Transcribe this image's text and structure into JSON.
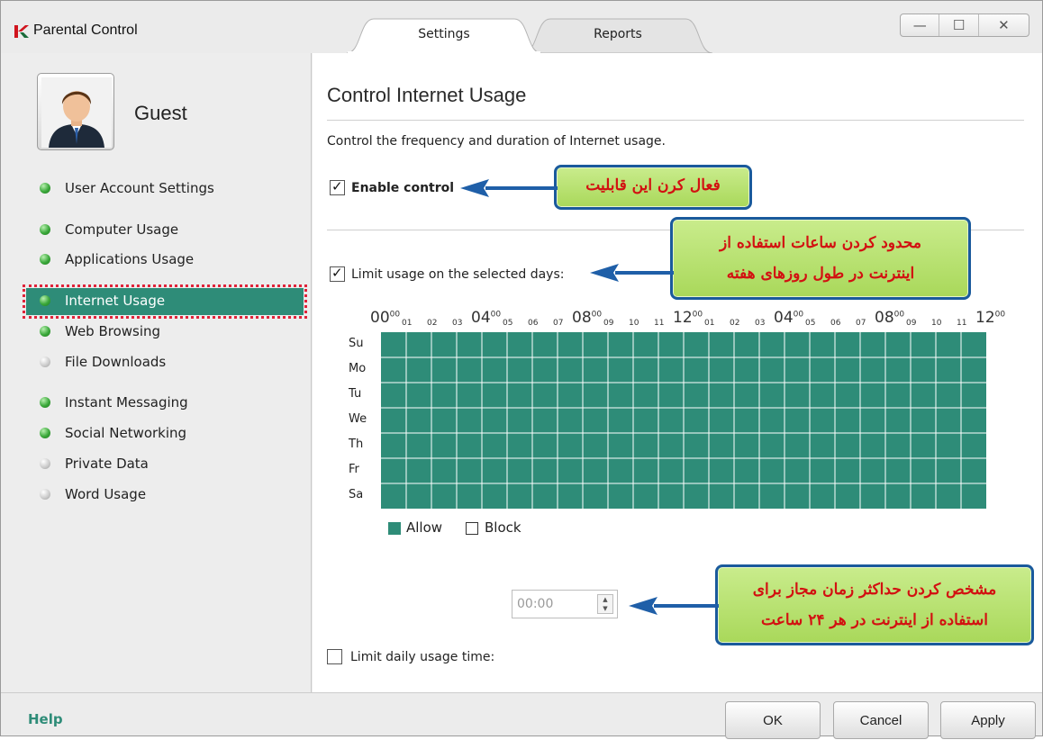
{
  "window": {
    "title": "Parental Control",
    "tabs": [
      "Settings",
      "Reports"
    ],
    "controls": [
      "—",
      "☐",
      "✕"
    ]
  },
  "sidebar": {
    "user": "Guest",
    "items": [
      {
        "label": "User Account Settings",
        "status": "green"
      },
      {
        "label": "Computer Usage",
        "status": "green"
      },
      {
        "label": "Applications Usage",
        "status": "green"
      },
      {
        "label": "Internet Usage",
        "status": "green",
        "selected": true
      },
      {
        "label": "Web Browsing",
        "status": "green"
      },
      {
        "label": "File Downloads",
        "status": "grey"
      },
      {
        "label": "Instant Messaging",
        "status": "green"
      },
      {
        "label": "Social Networking",
        "status": "green"
      },
      {
        "label": "Private Data",
        "status": "grey"
      },
      {
        "label": "Word Usage",
        "status": "grey"
      }
    ]
  },
  "main": {
    "title": "Control Internet Usage",
    "description": "Control the frequency and duration of Internet usage.",
    "enable_control": {
      "label": "Enable control",
      "checked": true
    },
    "limit_days": {
      "label": "Limit usage on the selected days:",
      "checked": true
    },
    "schedule": {
      "hour_labels": [
        "00",
        "01",
        "02",
        "03",
        "04",
        "05",
        "06",
        "07",
        "08",
        "09",
        "10",
        "11",
        "12",
        "01",
        "02",
        "03",
        "04",
        "05",
        "06",
        "07",
        "08",
        "09",
        "10",
        "11",
        "12"
      ],
      "hour_superscript": "00",
      "days": [
        "Su",
        "Mo",
        "Tu",
        "We",
        "Th",
        "Fr",
        "Sa"
      ],
      "state": "all allowed"
    },
    "legend": {
      "allow": "Allow",
      "block": "Block"
    },
    "limit_daily": {
      "label": "Limit daily usage time:",
      "checked": false,
      "value": "00:00"
    }
  },
  "callouts": {
    "enable": "فعال کرن این قابلیت",
    "days_line1": "محدود کردن ساعات استفاده از",
    "days_line2": "اینترنت در طول روزهای هفته",
    "daily_line1": "مشخص کردن حداکثر زمان مجاز برای",
    "daily_line2": "استفاده از اینترنت در هر ۲۴ ساعت"
  },
  "footer": {
    "help": "Help",
    "ok": "OK",
    "cancel": "Cancel",
    "apply": "Apply"
  },
  "colors": {
    "accent": "#2e8c78",
    "callout_border": "#1a5a9c",
    "callout_text": "#d21111",
    "selection_outline": "#e0243a"
  }
}
